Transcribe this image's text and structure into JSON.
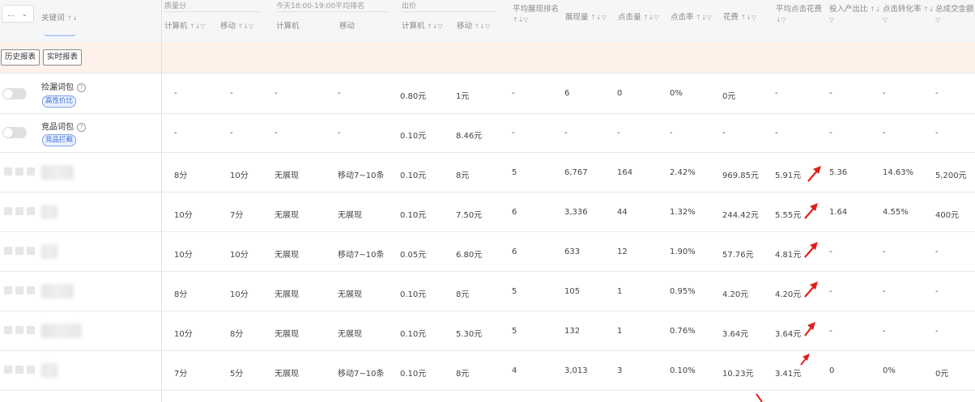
{
  "toolbar": {
    "dropdown_label": "...",
    "keyword_header": "关键词",
    "history_report_label": "历史报表",
    "realtime_report_label": "实时报表"
  },
  "header": {
    "group_quality": "质量分",
    "group_rank": "今天18:00-19:00平均排名",
    "group_bid": "出价",
    "quality_pc": "计算机",
    "quality_mobile": "移动",
    "rank_pc": "计算机",
    "rank_mobile": "移动",
    "bid_pc": "计算机",
    "bid_mobile": "移动",
    "avg_position": "平均展现排名",
    "impressions": "展现量",
    "clicks": "点击量",
    "ctr": "点击率",
    "cost": "花费",
    "avg_cpc": "平均点击花费",
    "roi": "投入产出比",
    "cvr": "点击转化率",
    "total_sales": "总成交金额"
  },
  "packages": [
    {
      "name": "捡漏词包",
      "tag": "高性价比",
      "cells": [
        "-",
        "-",
        "-",
        "-",
        "0.80元",
        "1元",
        "-",
        "6",
        "0",
        "0%",
        "0元",
        "-",
        "-",
        "-",
        "-"
      ]
    },
    {
      "name": "竞品词包",
      "tag": "竞品拦截",
      "cells": [
        "-",
        "-",
        "-",
        "-",
        "0.10元",
        "8.46元",
        "-",
        "-",
        "-",
        "-",
        "-",
        "-",
        "-",
        "-",
        "-"
      ]
    }
  ],
  "rows": [
    {
      "cells": [
        "8分",
        "10分",
        "无展现",
        "移动7~10条",
        "0.10元",
        "8元",
        "5",
        "6,767",
        "164",
        "2.42%",
        "969.85元",
        "5.91元",
        "5.36",
        "14.63%",
        "5,200元"
      ]
    },
    {
      "cells": [
        "10分",
        "7分",
        "无展现",
        "无展现",
        "0.10元",
        "7.50元",
        "6",
        "3,336",
        "44",
        "1.32%",
        "244.42元",
        "5.55元",
        "1.64",
        "4.55%",
        "400元"
      ]
    },
    {
      "cells": [
        "10分",
        "10分",
        "无展现",
        "移动7~10条",
        "0.05元",
        "6.80元",
        "6",
        "633",
        "12",
        "1.90%",
        "57.76元",
        "4.81元",
        "-",
        "-",
        "-"
      ]
    },
    {
      "cells": [
        "8分",
        "10分",
        "无展现",
        "无展现",
        "0.10元",
        "8元",
        "5",
        "105",
        "1",
        "0.95%",
        "4.20元",
        "4.20元",
        "-",
        "-",
        "-"
      ]
    },
    {
      "cells": [
        "10分",
        "8分",
        "无展现",
        "无展现",
        "0.10元",
        "5.30元",
        "5",
        "132",
        "1",
        "0.76%",
        "3.64元",
        "3.64元",
        "-",
        "-",
        "-"
      ]
    },
    {
      "cells": [
        "7分",
        "5分",
        "无展现",
        "移动7~10条",
        "0.10元",
        "8元",
        "4",
        "3,013",
        "3",
        "0.10%",
        "10.23元",
        "3.41元",
        "0",
        "0%",
        "0元"
      ]
    }
  ],
  "colors": {
    "band": "#fdf1ea",
    "header_bg": "#f5f6f8",
    "tag_blue": "#3a6fd8",
    "annotation_red": "#e0201a"
  },
  "icons": {
    "sort": "sort-icon",
    "filter": "filter-icon",
    "help": "help-icon",
    "arrow": "red-annotation-arrow"
  }
}
